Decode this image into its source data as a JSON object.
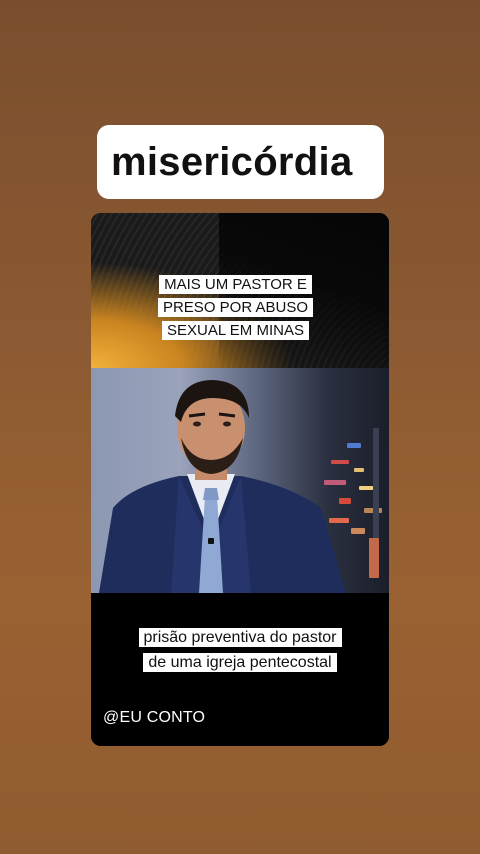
{
  "post": {
    "title": "misericórdia",
    "headline": "MAIS UM PASTOR E PRESO POR ABUSO SEXUAL EM MINAS",
    "caption": "prisão preventiva do pastor de uma igreja pentecostal",
    "handle": "@EU CONTO"
  },
  "colors": {
    "background": "#8c5a32",
    "chip": "#ffffff",
    "card": "#000000",
    "accent_gold": "#f2b23a"
  }
}
